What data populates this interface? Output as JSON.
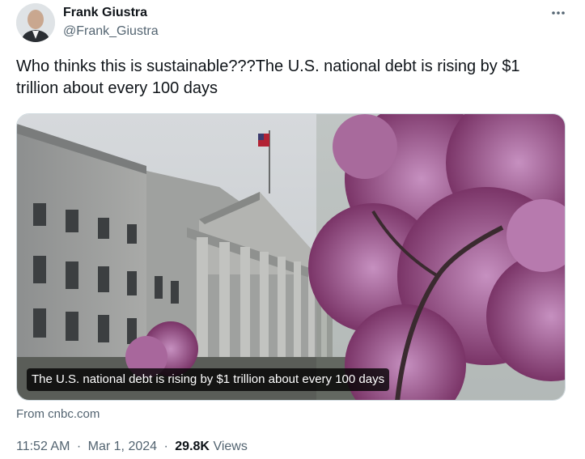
{
  "author": {
    "name": "Frank Giustra",
    "handle": "@Frank_Giustra"
  },
  "menu_icon": "more-horizontal-icon",
  "tweet": {
    "text": "Who thinks this is sustainable???The U.S. national debt is rising by $1 trillion about every 100 days"
  },
  "card": {
    "caption": "The U.S. national debt is rising by $1 trillion about every 100 days",
    "source": "From cnbc.com"
  },
  "meta": {
    "time": "11:52 AM",
    "date": "Mar 1, 2024",
    "separator": "·",
    "views_count": "29.8K",
    "views_label": "Views"
  },
  "colors": {
    "text": "#0f1419",
    "secondary": "#536471",
    "border": "#cfd9de",
    "blossom": "#9b4f8a"
  }
}
